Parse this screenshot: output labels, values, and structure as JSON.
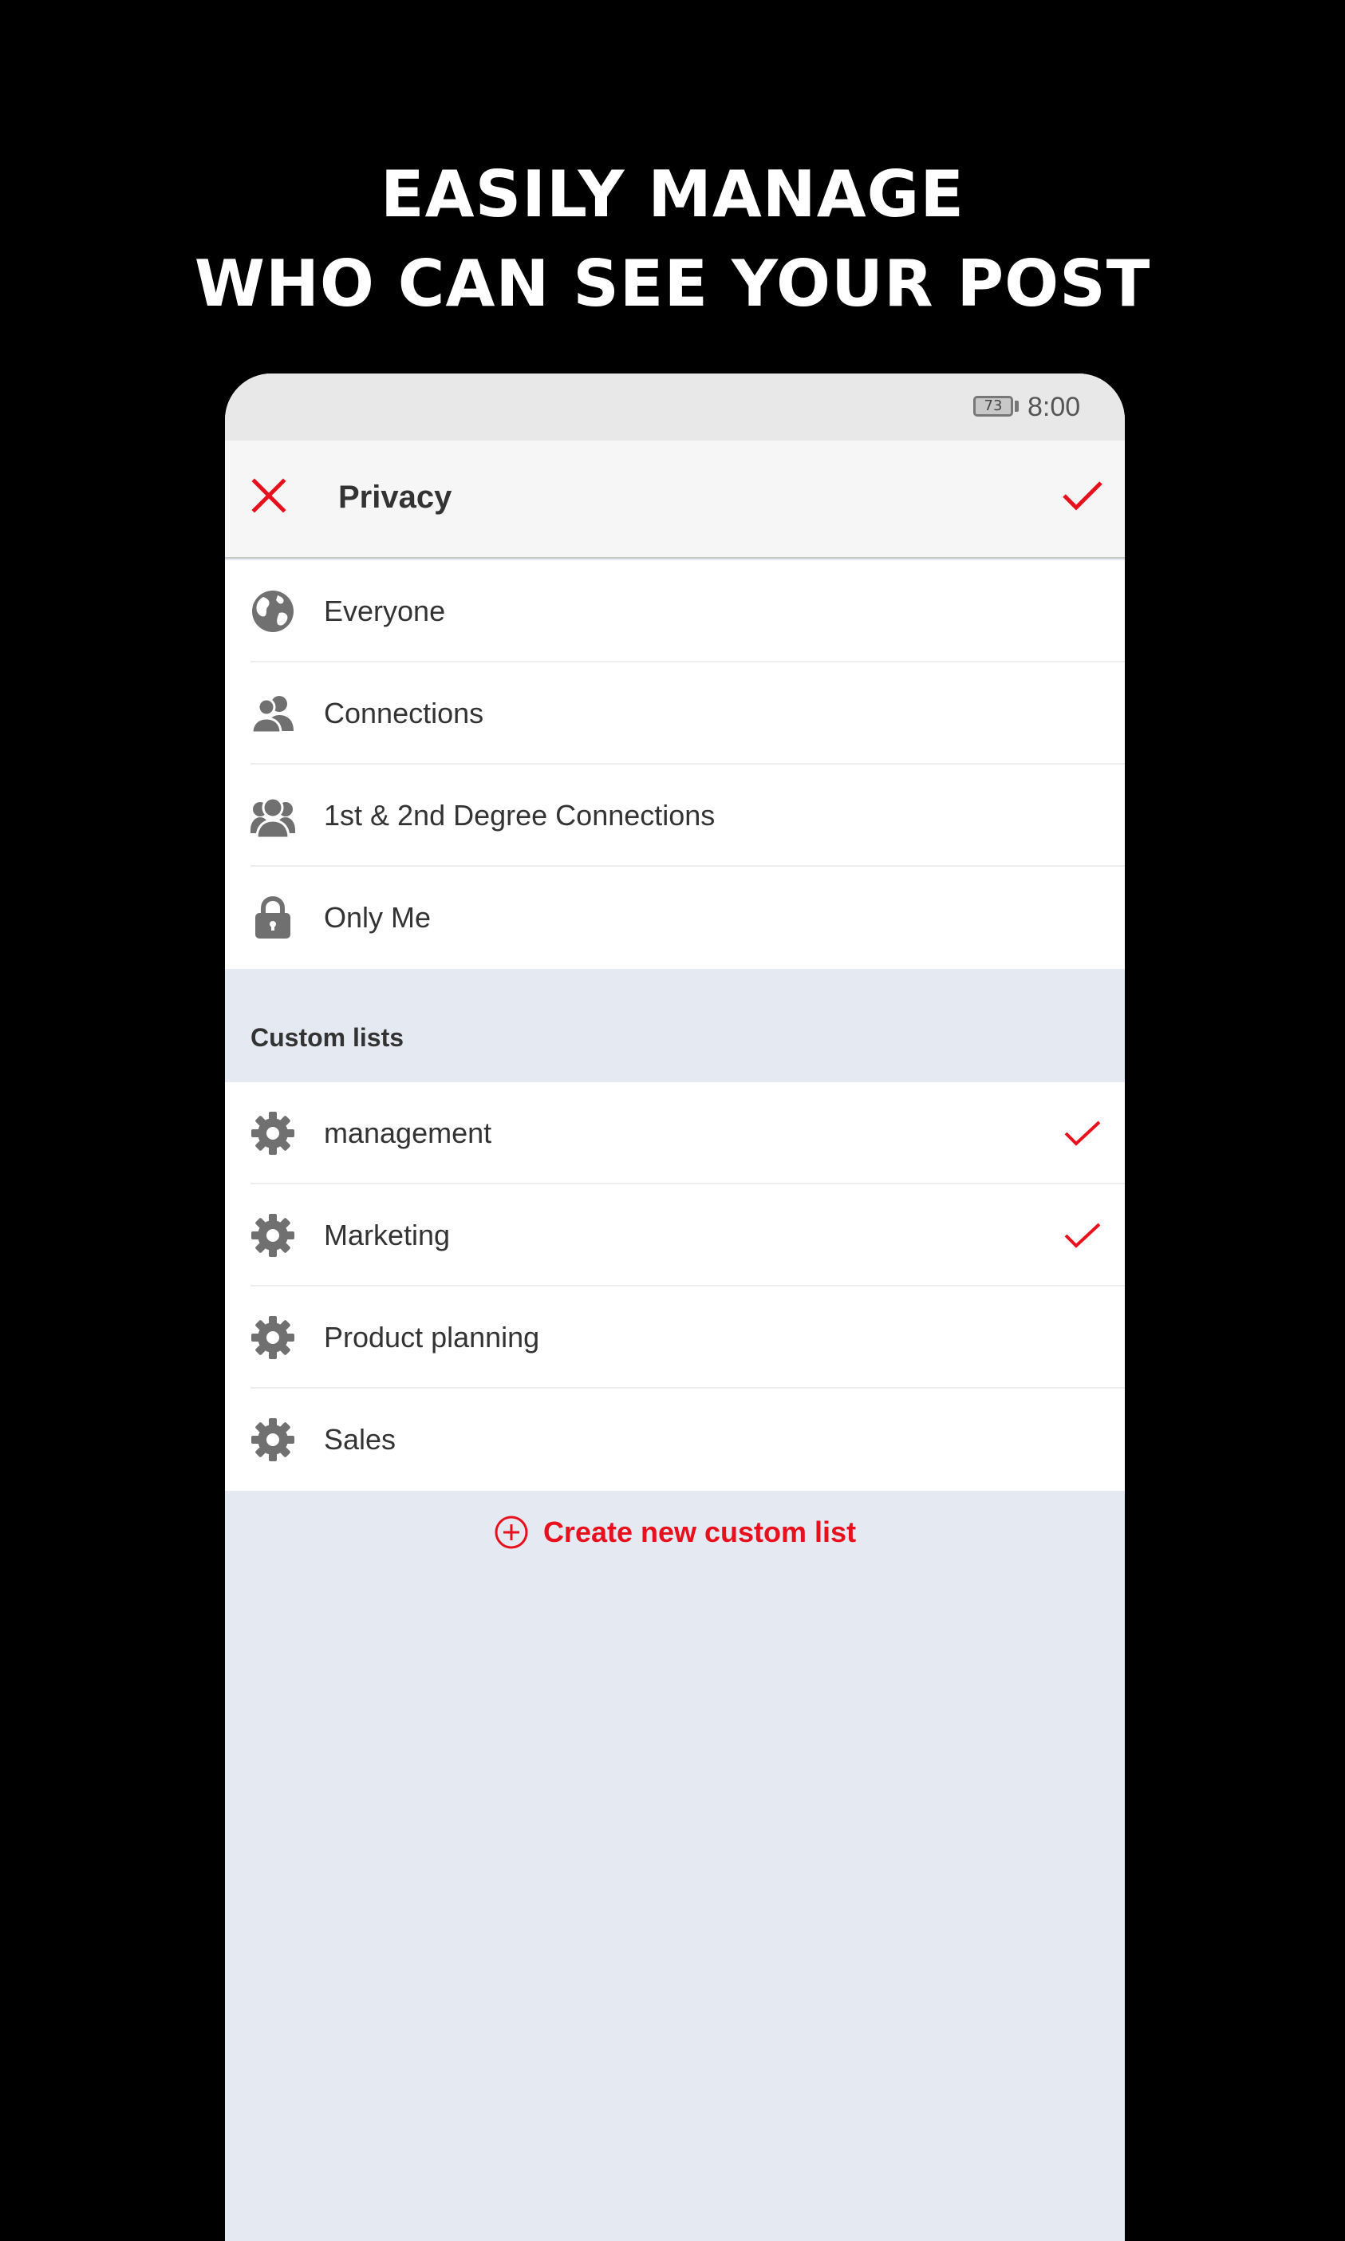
{
  "promo": {
    "line1": "EASILY MANAGE",
    "line2": "WHO CAN SEE YOUR POST"
  },
  "status_bar": {
    "battery": "73",
    "time": "8:00"
  },
  "app_bar": {
    "title": "Privacy",
    "close_icon": "close-icon",
    "confirm_icon": "checkmark-icon"
  },
  "privacy_options": [
    {
      "label": "Everyone",
      "icon": "globe-icon"
    },
    {
      "label": "Connections",
      "icon": "people-icon"
    },
    {
      "label": "1st & 2nd Degree Connections",
      "icon": "group-icon"
    },
    {
      "label": "Only Me",
      "icon": "lock-icon"
    }
  ],
  "custom_lists": {
    "header": "Custom lists",
    "items": [
      {
        "label": "management",
        "icon": "gear-icon",
        "selected": true
      },
      {
        "label": "Marketing",
        "icon": "gear-icon",
        "selected": true
      },
      {
        "label": "Product planning",
        "icon": "gear-icon",
        "selected": false
      },
      {
        "label": "Sales",
        "icon": "gear-icon",
        "selected": false
      }
    ],
    "create_label": "Create new custom list"
  },
  "colors": {
    "accent": "#e8101c",
    "icon": "#707070",
    "section_bg": "#e4e9f2"
  }
}
